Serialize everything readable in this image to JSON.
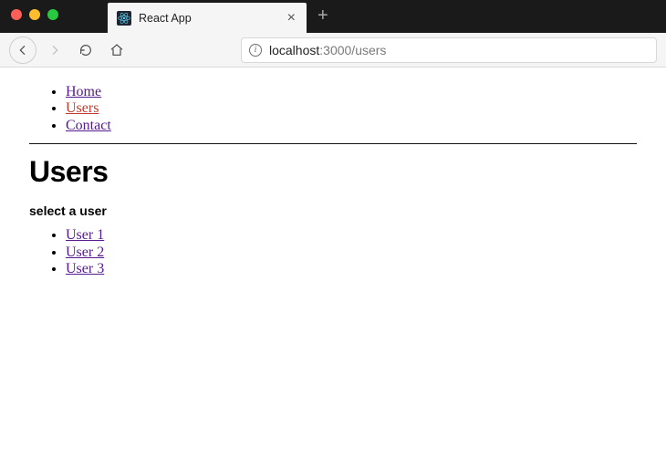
{
  "browser": {
    "tab_title": "React App",
    "url_host": "localhost",
    "url_port_path": ":3000/users"
  },
  "nav": {
    "items": [
      {
        "label": "Home",
        "active": false
      },
      {
        "label": "Users",
        "active": true
      },
      {
        "label": "Contact",
        "active": false
      }
    ]
  },
  "page": {
    "heading": "Users",
    "subheading": "select a user",
    "users": [
      {
        "label": "User 1"
      },
      {
        "label": "User 2"
      },
      {
        "label": "User 3"
      }
    ]
  }
}
